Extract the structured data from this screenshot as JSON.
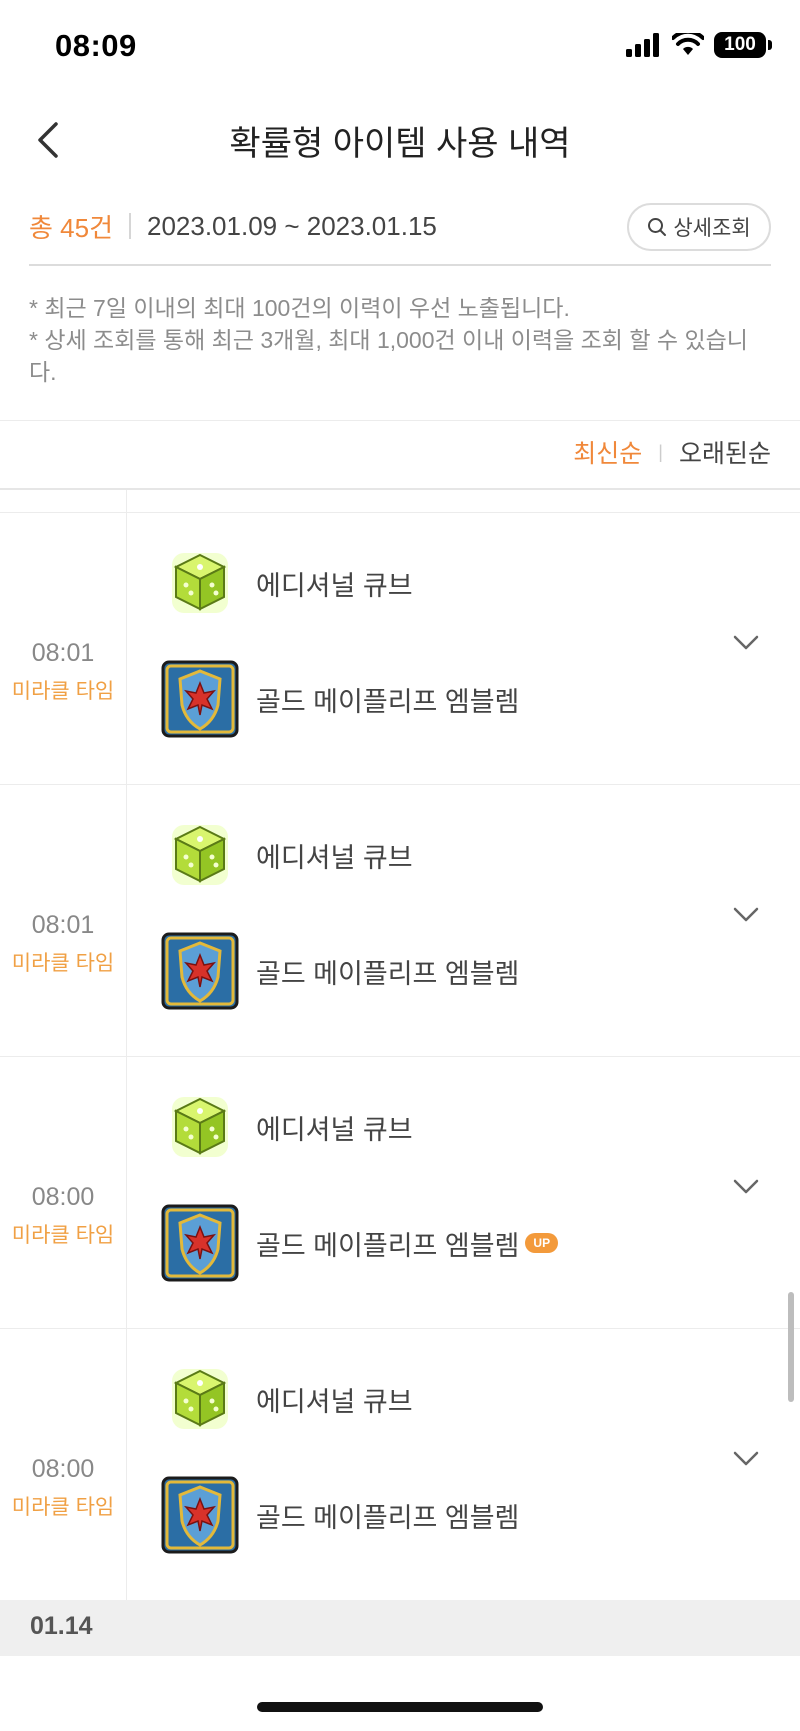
{
  "status_bar": {
    "time": "08:09",
    "battery": "100"
  },
  "header": {
    "title": "확률형 아이템 사용 내역"
  },
  "summary": {
    "total": "총 45건",
    "date_range": "2023.01.09 ~ 2023.01.15",
    "detail_search_label": "상세조회"
  },
  "notice": {
    "line1": "* 최근 7일 이내의 최대 100건의 이력이 우선 노출됩니다.",
    "line2": "* 상세 조회를 통해 최근 3개월, 최대 1,000건 이내 이력을 조회 할 수 있습니다."
  },
  "sort": {
    "newest": "최신순",
    "oldest": "오래된순",
    "active": "newest"
  },
  "entries": [
    {
      "time": "08:01",
      "event": "미라클 타임",
      "item1": "에디셔널 큐브",
      "item2": "골드 메이플리프 엠블렘",
      "badge": ""
    },
    {
      "time": "08:01",
      "event": "미라클 타임",
      "item1": "에디셔널 큐브",
      "item2": "골드 메이플리프 엠블렘",
      "badge": ""
    },
    {
      "time": "08:00",
      "event": "미라클 타임",
      "item1": "에디셔널 큐브",
      "item2": "골드 메이플리프 엠블렘",
      "badge": "UP"
    },
    {
      "time": "08:00",
      "event": "미라클 타임",
      "item1": "에디셔널 큐브",
      "item2": "골드 메이플리프 엠블렘",
      "badge": ""
    }
  ],
  "date_header": "01.14",
  "icons": {
    "back": "chevron-left-icon",
    "search": "search-icon",
    "expand": "chevron-down-icon",
    "cube": "additional-cube-icon",
    "emblem": "gold-maple-leaf-emblem-icon"
  },
  "colors": {
    "accent": "#f0883a",
    "event": "#f0a044",
    "badge": "#f39a3b"
  }
}
